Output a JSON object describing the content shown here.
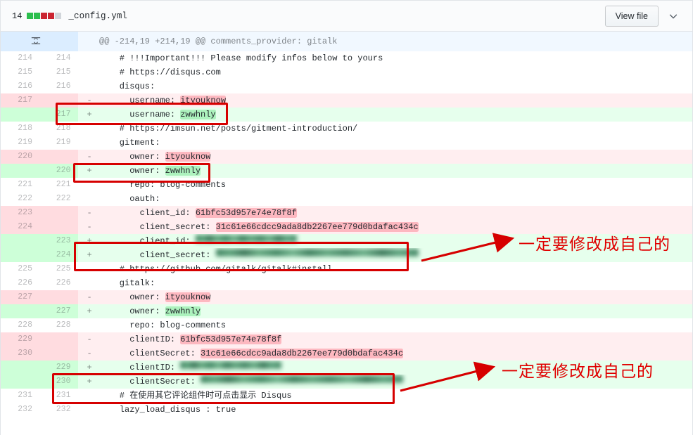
{
  "header": {
    "changes_count": "14",
    "diffstat_blocks": [
      "add",
      "add",
      "del",
      "del",
      "neutral"
    ],
    "file_name": "_config.yml",
    "view_file_label": "View file",
    "chevron_icon": "chevron-down-icon",
    "colors": {
      "add": "#2cbe4e",
      "del": "#cb2431",
      "neutral": "#d1d5da",
      "annotation": "#d60000"
    }
  },
  "hunk": {
    "expand_icon": "unfold-expand-icon",
    "text": "@@ -214,19 +214,19 @@ comments_provider: gitalk"
  },
  "rows": [
    {
      "type": "ctx",
      "old": "214",
      "new": "214",
      "sign": " ",
      "code": "    # !!!Important!!! Please modify infos below to yours"
    },
    {
      "type": "ctx",
      "old": "215",
      "new": "215",
      "sign": " ",
      "code": "    # https://disqus.com"
    },
    {
      "type": "ctx",
      "old": "216",
      "new": "216",
      "sign": " ",
      "code": "    disqus:"
    },
    {
      "type": "del",
      "old": "217",
      "new": "",
      "sign": "-",
      "pre": "      username: ",
      "hl": "ityouknow",
      "post": ""
    },
    {
      "type": "add",
      "old": "",
      "new": "217",
      "sign": "+",
      "pre": "      username: ",
      "hl": "zwwhnly",
      "post": ""
    },
    {
      "type": "ctx",
      "old": "218",
      "new": "218",
      "sign": " ",
      "code": "    # https://imsun.net/posts/gitment-introduction/"
    },
    {
      "type": "ctx",
      "old": "219",
      "new": "219",
      "sign": " ",
      "code": "    gitment:"
    },
    {
      "type": "del",
      "old": "220",
      "new": "",
      "sign": "-",
      "pre": "      owner: ",
      "hl": "ityouknow",
      "post": ""
    },
    {
      "type": "add",
      "old": "",
      "new": "220",
      "sign": "+",
      "pre": "      owner: ",
      "hl": "zwwhnly",
      "post": ""
    },
    {
      "type": "ctx",
      "old": "221",
      "new": "221",
      "sign": " ",
      "code": "      repo: blog-comments"
    },
    {
      "type": "ctx",
      "old": "222",
      "new": "222",
      "sign": " ",
      "code": "      oauth:"
    },
    {
      "type": "del",
      "old": "223",
      "new": "",
      "sign": "-",
      "pre": "        client_id: ",
      "hl": "61bfc53d957e74e78f8f",
      "post": ""
    },
    {
      "type": "del",
      "old": "224",
      "new": "",
      "sign": "-",
      "pre": "        client_secret: ",
      "hl": "31c61e66cdcc9ada8db2267ee779d0bdafac434c",
      "post": ""
    },
    {
      "type": "add",
      "old": "",
      "new": "223",
      "sign": "+",
      "pre": "        client_id: ",
      "redacted": 20,
      "post": ""
    },
    {
      "type": "add",
      "old": "",
      "new": "224",
      "sign": "+",
      "pre": "        client_secret: ",
      "redacted": 40,
      "post": ""
    },
    {
      "type": "ctx",
      "old": "225",
      "new": "225",
      "sign": " ",
      "code": "    # https://github.com/gitalk/gitalk#install"
    },
    {
      "type": "ctx",
      "old": "226",
      "new": "226",
      "sign": " ",
      "code": "    gitalk:"
    },
    {
      "type": "del",
      "old": "227",
      "new": "",
      "sign": "-",
      "pre": "      owner: ",
      "hl": "ityouknow",
      "post": ""
    },
    {
      "type": "add",
      "old": "",
      "new": "227",
      "sign": "+",
      "pre": "      owner: ",
      "hl": "zwwhnly",
      "post": ""
    },
    {
      "type": "ctx",
      "old": "228",
      "new": "228",
      "sign": " ",
      "code": "      repo: blog-comments"
    },
    {
      "type": "del",
      "old": "229",
      "new": "",
      "sign": "-",
      "pre": "      clientID: ",
      "hl": "61bfc53d957e74e78f8f",
      "post": ""
    },
    {
      "type": "del",
      "old": "230",
      "new": "",
      "sign": "-",
      "pre": "      clientSecret: ",
      "hl": "31c61e66cdcc9ada8db2267ee779d0bdafac434c",
      "post": ""
    },
    {
      "type": "add",
      "old": "",
      "new": "229",
      "sign": "+",
      "pre": "      clientID: ",
      "redacted": 20,
      "post": ""
    },
    {
      "type": "add",
      "old": "",
      "new": "230",
      "sign": "+",
      "pre": "      clientSecret: ",
      "redacted": 40,
      "post": ""
    },
    {
      "type": "ctx",
      "old": "231",
      "new": "231",
      "sign": " ",
      "code": "    # 在使用其它评论组件时可点击显示 Disqus"
    },
    {
      "type": "ctx",
      "old": "232",
      "new": "232",
      "sign": " ",
      "code": "    lazy_load_disqus : true"
    }
  ],
  "annotations": {
    "note_1": "一定要修改成自己的",
    "note_2": "一定要修改成自己的"
  }
}
